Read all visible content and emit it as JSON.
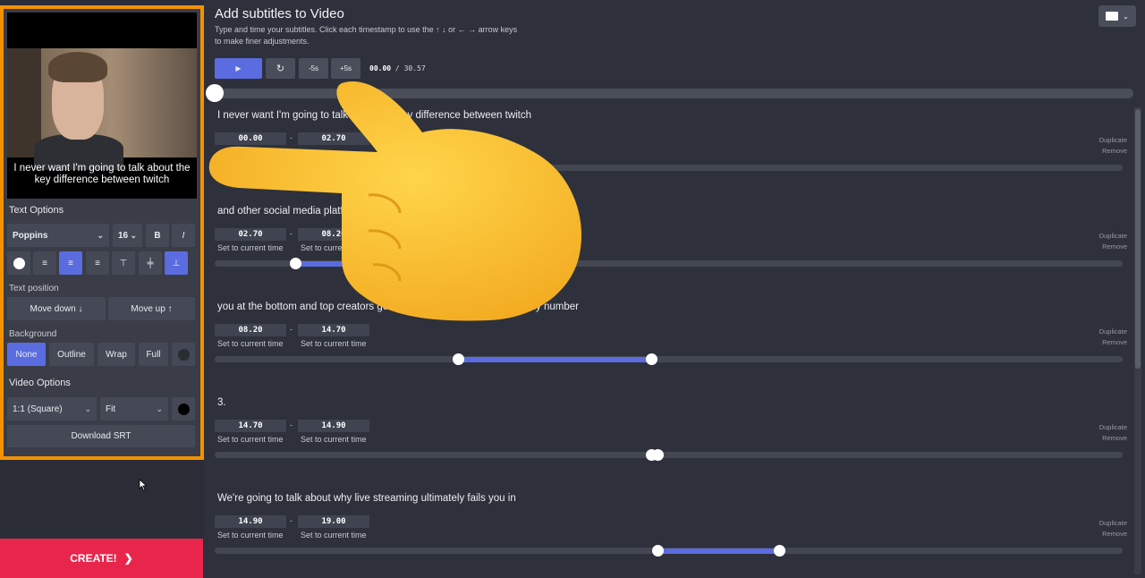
{
  "video": {
    "caption": "I never want I'm going to talk about the key difference between twitch"
  },
  "text_options": {
    "title": "Text Options",
    "font": "Poppins",
    "size": "16",
    "bold": "B",
    "italic": "I",
    "text_position_label": "Text position",
    "move_down": "Move down ↓",
    "move_up": "Move up ↑"
  },
  "background": {
    "label": "Background",
    "options": [
      "None",
      "Outline",
      "Wrap",
      "Full"
    ],
    "selected": "None"
  },
  "video_options": {
    "title": "Video Options",
    "aspect": "1:1 (Square)",
    "fit": "Fit",
    "download": "Download SRT"
  },
  "create_label": "CREATE!",
  "main": {
    "title": "Add subtitles to Video",
    "description": "Type and time your subtitles. Click each timestamp to use the ↑ ↓ or ← → arrow keys to make finer adjustments.",
    "minus5": "-5s",
    "plus5": "+5s",
    "current_time": "00.00",
    "separator": "/",
    "total_time": "30.57",
    "playhead_fraction": 0.0
  },
  "row_labels": {
    "set_current": "Set to current time",
    "duplicate": "Duplicate",
    "remove": "Remove",
    "dash": "-"
  },
  "subtitles": [
    {
      "text": "I never want I'm going to talk about the key difference between twitch",
      "start": "00.00",
      "end": "02.70",
      "start_s": 0.0,
      "end_s": 2.7
    },
    {
      "text": "and other social media platforms",
      "start": "02.70",
      "end": "08.20",
      "start_s": 2.7,
      "end_s": 8.2
    },
    {
      "text": "you at the bottom and top creators get the vast majority of views, vastly number",
      "start": "08.20",
      "end": "14.70",
      "start_s": 8.2,
      "end_s": 14.7
    },
    {
      "text": "3.",
      "start": "14.70",
      "end": "14.90",
      "start_s": 14.7,
      "end_s": 14.9
    },
    {
      "text": "We're going to talk about why live streaming ultimately fails you in",
      "start": "14.90",
      "end": "19.00",
      "start_s": 14.9,
      "end_s": 19.0
    }
  ],
  "colors": {
    "accent": "#5a6ce0",
    "create": "#e8264c",
    "highlight_border": "#f39200"
  }
}
